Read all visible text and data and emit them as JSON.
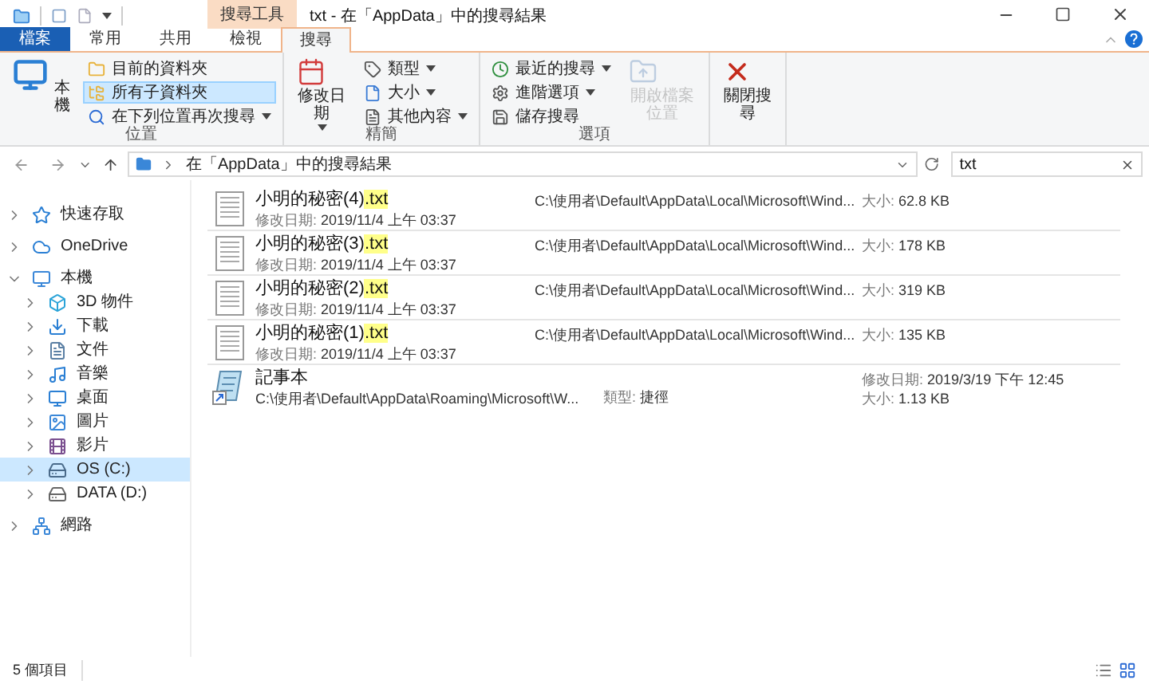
{
  "window": {
    "title": "txt - 在「AppData」中的搜尋結果",
    "context_tab": "搜尋工具"
  },
  "tabs": [
    {
      "label": "檔案",
      "kind": "file",
      "selected": false
    },
    {
      "label": "常用",
      "kind": "normal",
      "selected": false
    },
    {
      "label": "共用",
      "kind": "normal",
      "selected": false
    },
    {
      "label": "檢視",
      "kind": "normal",
      "selected": false
    },
    {
      "label": "搜尋",
      "kind": "context",
      "selected": true
    }
  ],
  "ribbon": {
    "groups": [
      {
        "label": "位置",
        "items": [
          {
            "label": "本機",
            "kind": "large",
            "vertical": true
          },
          {
            "label": "目前的資料夾",
            "kind": "small",
            "selected": false
          },
          {
            "label": "所有子資料夾",
            "kind": "small",
            "selected": true
          },
          {
            "label": "在下列位置再次搜尋",
            "kind": "small",
            "dropdown": true,
            "selected": false
          }
        ]
      },
      {
        "label": "精簡",
        "items": [
          {
            "label": "修改日期",
            "kind": "large",
            "dropdown": true
          },
          {
            "label": "類型",
            "kind": "small",
            "dropdown": true,
            "selected": false
          },
          {
            "label": "大小",
            "kind": "small",
            "dropdown": true,
            "selected": false
          },
          {
            "label": "其他內容",
            "kind": "small",
            "dropdown": true,
            "selected": false
          }
        ]
      },
      {
        "label": "選項",
        "items": [
          {
            "label": "最近的搜尋",
            "kind": "small",
            "dropdown": true,
            "selected": false
          },
          {
            "label": "進階選項",
            "kind": "small",
            "dropdown": true,
            "selected": false
          },
          {
            "label": "儲存搜尋",
            "kind": "small",
            "selected": false
          },
          {
            "label": "開啟檔案位置",
            "kind": "large",
            "disabled": true
          }
        ]
      },
      {
        "items": [
          {
            "label": "關閉搜尋",
            "kind": "large"
          }
        ]
      }
    ]
  },
  "address": {
    "path": "在「AppData」中的搜尋結果",
    "search_value": "txt"
  },
  "sidebar": {
    "items": [
      {
        "label": "快速存取",
        "expanded": false,
        "selected": false
      },
      {
        "label": "OneDrive",
        "expanded": false,
        "selected": false
      },
      {
        "label": "本機",
        "expanded": true,
        "selected": false,
        "children": [
          {
            "label": "3D 物件",
            "expanded": false,
            "selected": false
          },
          {
            "label": "下載",
            "expanded": false,
            "selected": false
          },
          {
            "label": "文件",
            "expanded": false,
            "selected": false
          },
          {
            "label": "音樂",
            "expanded": false,
            "selected": false
          },
          {
            "label": "桌面",
            "expanded": false,
            "selected": false
          },
          {
            "label": "圖片",
            "expanded": false,
            "selected": false
          },
          {
            "label": "影片",
            "expanded": false,
            "selected": false
          },
          {
            "label": "OS (C:)",
            "expanded": false,
            "selected": true
          },
          {
            "label": "DATA (D:)",
            "expanded": false,
            "selected": false
          }
        ]
      },
      {
        "label": "網路",
        "expanded": false,
        "selected": false
      }
    ]
  },
  "results": [
    {
      "kind": "text",
      "name": "小明的秘密(4)",
      "match": ".txt",
      "date_label": "修改日期:",
      "date": "2019/11/4 上午 03:37",
      "path": "C:\\使用者\\Default\\AppData\\Local\\Microsoft\\Wind...",
      "size_label": "大小:",
      "size": "62.8 KB"
    },
    {
      "kind": "text",
      "name": "小明的秘密(3)",
      "match": ".txt",
      "date_label": "修改日期:",
      "date": "2019/11/4 上午 03:37",
      "path": "C:\\使用者\\Default\\AppData\\Local\\Microsoft\\Wind...",
      "size_label": "大小:",
      "size": "178 KB"
    },
    {
      "kind": "text",
      "name": "小明的秘密(2)",
      "match": ".txt",
      "date_label": "修改日期:",
      "date": "2019/11/4 上午 03:37",
      "path": "C:\\使用者\\Default\\AppData\\Local\\Microsoft\\Wind...",
      "size_label": "大小:",
      "size": "319 KB"
    },
    {
      "kind": "text",
      "name": "小明的秘密(1)",
      "match": ".txt",
      "date_label": "修改日期:",
      "date": "2019/11/4 上午 03:37",
      "path": "C:\\使用者\\Default\\AppData\\Local\\Microsoft\\Wind...",
      "size_label": "大小:",
      "size": "135 KB"
    },
    {
      "kind": "shortcut",
      "name": "記事本",
      "path": "C:\\使用者\\Default\\AppData\\Roaming\\Microsoft\\W...",
      "type_label": "類型:",
      "type": "捷徑",
      "date_label": "修改日期:",
      "date": "2019/3/19 下午 12:45",
      "size_label": "大小:",
      "size": "1.13 KB"
    }
  ],
  "status_bar": {
    "count": "5 個項目"
  }
}
